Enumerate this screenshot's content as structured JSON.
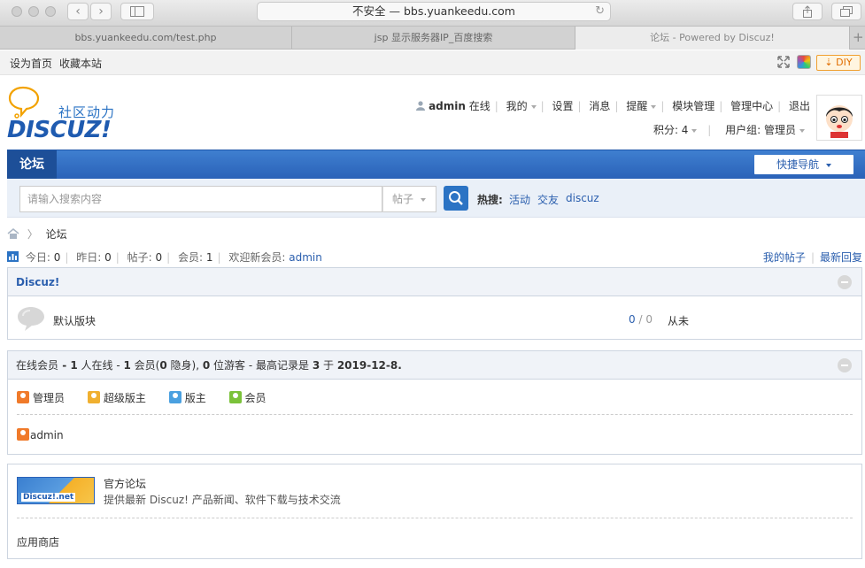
{
  "browser": {
    "address": "不安全 — bbs.yuankeedu.com",
    "tabs": [
      "bbs.yuankeedu.com/test.php",
      "jsp 显示服务器IP_百度搜索",
      "论坛 - Powered by Discuz!"
    ],
    "new_tab": "+"
  },
  "toptb": {
    "set_home": "设为首页",
    "bookmark": "收藏本站",
    "diy": "DIY"
  },
  "logo": {
    "slogan": "社区动力",
    "wordmark": "DISCUZ!"
  },
  "user": {
    "name": "admin",
    "status": "在线",
    "links": [
      "我的",
      "设置",
      "消息",
      "提醒",
      "模块管理",
      "管理中心",
      "退出"
    ],
    "credits": "积分: 4",
    "group": "用户组: 管理员"
  },
  "nav": {
    "forum": "论坛",
    "quick_nav": "快捷导航"
  },
  "search": {
    "placeholder": "请输入搜索内容",
    "type": "帖子",
    "hot_label": "热搜:",
    "hot_words": [
      "活动",
      "交友",
      "discuz"
    ]
  },
  "breadcrumb": {
    "current": "论坛"
  },
  "stats": {
    "today_label": "今日:",
    "today": "0",
    "yesterday_label": "昨日:",
    "yesterday": "0",
    "posts_label": "帖子:",
    "posts": "0",
    "members_label": "会员:",
    "members": "1",
    "welcome_label": "欢迎新会员:",
    "newest": "admin",
    "my_posts": "我的帖子",
    "latest_replies": "最新回复"
  },
  "category": {
    "title": "Discuz!",
    "forum_name": "默认版块",
    "threads": "0",
    "slash": "/",
    "posts": "0",
    "last_post": "从未"
  },
  "online": {
    "t1": "在线会员",
    "t2": " - ",
    "t3": "1",
    "t4": " 人在线 - ",
    "t5": "1",
    "t6": " 会员(",
    "t7": "0",
    "t8": " 隐身), ",
    "t9": "0",
    "t10": " 位游客 - 最高记录是 ",
    "t11": "3",
    "t12": " 于 ",
    "t13": "2019-12-8.",
    "legend": [
      "管理员",
      "超级版主",
      "版主",
      "会员"
    ],
    "legend_colors": [
      "#f07a2a",
      "#f0b030",
      "#4aa0e0",
      "#7bc23a"
    ],
    "users": [
      "admin"
    ]
  },
  "links": {
    "banner_text": "Discuz!.net",
    "site_name": "官方论坛",
    "site_desc": "提供最新 Discuz! 产品新闻、软件下载与技术交流",
    "app_store": "应用商店"
  }
}
